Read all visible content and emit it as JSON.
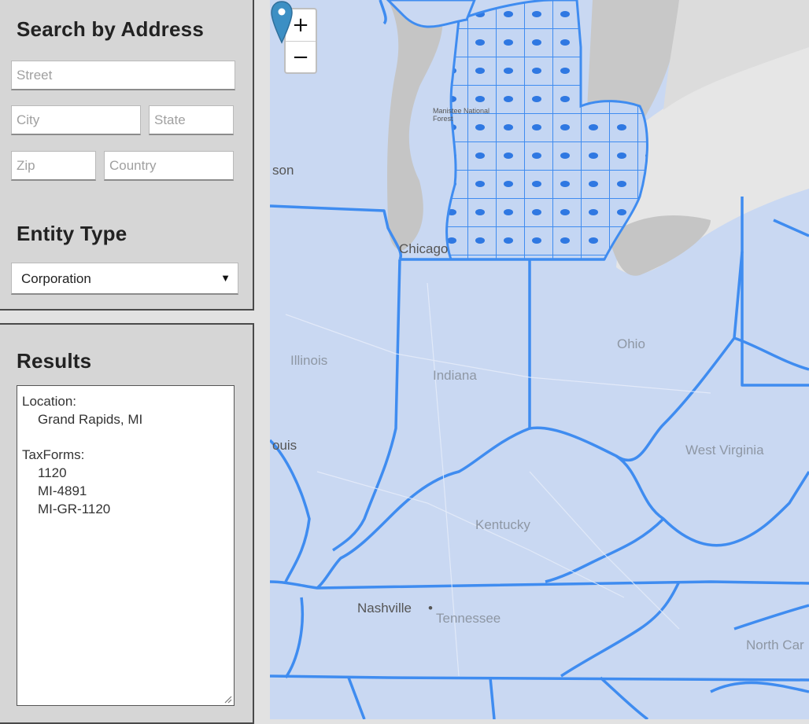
{
  "search": {
    "title": "Search by Address",
    "street_placeholder": "Street",
    "city_placeholder": "City",
    "state_placeholder": "State",
    "zip_placeholder": "Zip",
    "country_placeholder": "Country"
  },
  "entity": {
    "title": "Entity Type",
    "selected": "Corporation"
  },
  "results": {
    "title": "Results",
    "location_label": "Location:",
    "location_value": "Grand Rapids, MI",
    "taxforms_label": "TaxForms:",
    "taxforms": [
      "1120",
      "MI-4891",
      "MI-GR-1120"
    ]
  },
  "map": {
    "zoom_in": "+",
    "zoom_out": "−",
    "states": {
      "illinois": "Illinois",
      "indiana": "Indiana",
      "ohio": "Ohio",
      "west_virginia": "West Virginia",
      "kentucky": "Kentucky",
      "tennessee": "Tennessee",
      "north_carolina": "North Car"
    },
    "cities": {
      "chicago": "Chicago",
      "nashville": "Nashville",
      "st_louis": "ouis",
      "madison": "son"
    },
    "forest_label": "Manistee National Forest",
    "region_color": "#3f8cf0",
    "marker_color": "#3c8fc4"
  }
}
